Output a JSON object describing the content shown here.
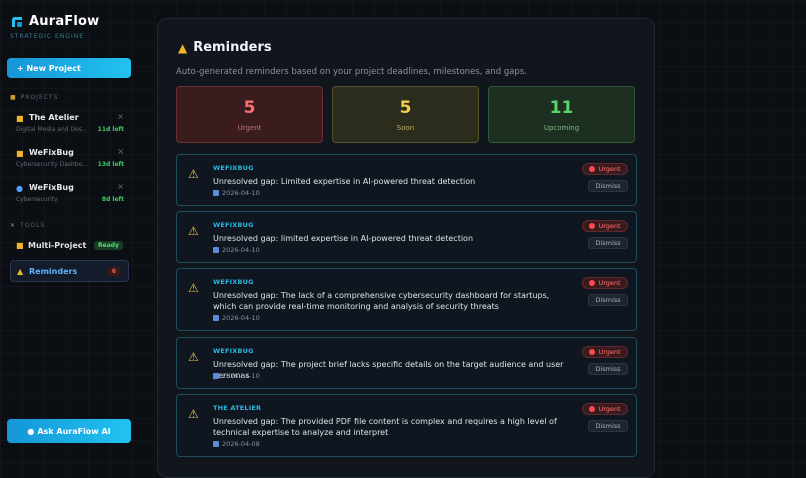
{
  "brand": {
    "name": "AuraFlow",
    "tagline": "STRATEGIC ENGINE"
  },
  "sidebar": {
    "new_project_label": "+ New Project",
    "projects_heading": "PROJECTS",
    "projects": [
      {
        "name": "The Atelier",
        "desc": "Digital Media and Des...",
        "days": "11d left",
        "icon": "folder-icon"
      },
      {
        "name": "WeFixBug",
        "desc": "Cybersecurity Dashbo...",
        "days": "13d left",
        "icon": "folder-icon"
      },
      {
        "name": "WeFixBug",
        "desc": "Cybersecurity",
        "days": "8d left",
        "icon": "search-icon"
      }
    ],
    "close_glyph": "×",
    "tools_heading": "TOOLS",
    "tools": [
      {
        "label": "Multi-Project",
        "badge": "Ready"
      },
      {
        "label": "Reminders",
        "badge": "6"
      }
    ],
    "ask_ai_label": "Ask AuraFlow AI"
  },
  "main": {
    "title": "Reminders",
    "subtitle": "Auto-generated reminders based on your project deadlines, milestones, and gaps.",
    "stats": {
      "urgent": {
        "value": "5",
        "label": "Urgent"
      },
      "soon": {
        "value": "5",
        "label": "Soon"
      },
      "upcoming": {
        "value": "11",
        "label": "Upcoming"
      }
    },
    "reminders": [
      {
        "project": "WEFIXBUG",
        "text": "Unresolved gap: Limited expertise in AI-powered threat detection",
        "date": "2026-04-10",
        "badge": "Urgent",
        "action": "Dismiss"
      },
      {
        "project": "WEFIXBUG",
        "text": "Unresolved gap: limited expertise in AI-powered threat detection",
        "date": "2026-04-10",
        "badge": "Urgent",
        "action": "Dismiss"
      },
      {
        "project": "WEFIXBUG",
        "text": "Unresolved gap: The lack of a comprehensive cybersecurity dashboard for startups, which can provide real-time monitoring and analysis of security threats",
        "date": "2026-04-10",
        "badge": "Urgent",
        "action": "Dismiss"
      },
      {
        "project": "WEFIXBUG",
        "text": "Unresolved gap: The project brief lacks specific details on the target audience and user personas",
        "date": "2026-04-10",
        "badge": "Urgent",
        "action": "Dismiss"
      },
      {
        "project": "THE ATELIER",
        "text": "Unresolved gap: The provided PDF file content is complex and requires a high level of technical expertise to analyze and interpret",
        "date": "2026-04-08",
        "badge": "Urgent",
        "action": "Dismiss"
      }
    ]
  },
  "colors": {
    "accent": "#21c2f0",
    "urgent": "#ff6b6b",
    "soon": "#f2d04d",
    "upcoming": "#5ad46a"
  }
}
